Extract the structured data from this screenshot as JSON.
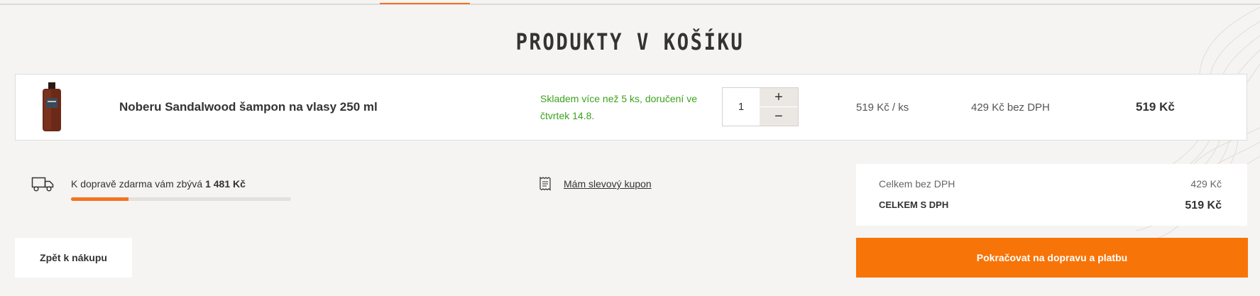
{
  "page": {
    "title": "PRODUKTY V KOŠÍKU"
  },
  "cart": {
    "item": {
      "name": "Noberu Sandalwood šampon na vlasy 250 ml",
      "availability": "Skladem více než 5 ks, doručení ve čtvrtek 14.8.",
      "quantity": "1",
      "plus_symbol": "+",
      "minus_symbol": "−",
      "unit_price": "519 Kč / ks",
      "price_without_vat": "429 Kč bez DPH",
      "total": "519 Kč"
    }
  },
  "shipping": {
    "text": "K dopravě zdarma vám zbývá",
    "remaining": "1 481 Kč",
    "progress_percent": 26,
    "icon": "truck-icon"
  },
  "coupon": {
    "label": "Mám slevový kupon",
    "icon": "coupon-icon"
  },
  "summary": {
    "without_vat_label": "Celkem bez DPH",
    "without_vat_value": "429 Kč",
    "with_vat_label": "CELKEM S DPH",
    "with_vat_value": "519 Kč"
  },
  "actions": {
    "back_label": "Zpět k nákupu",
    "continue_label": "Pokračovat na dopravu a platbu"
  },
  "colors": {
    "accent": "#f47320",
    "stock": "#3aa31e",
    "background": "#f5f4f2"
  }
}
